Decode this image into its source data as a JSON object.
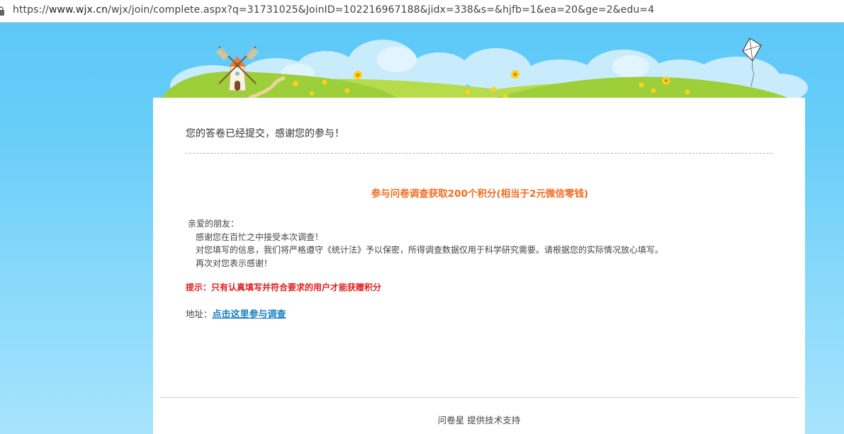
{
  "browser": {
    "url_prefix": "https://",
    "url_host": "www.wjx.cn",
    "url_rest": "/wjx/join/complete.aspx?q=31731025&JoinID=102216967188&jidx=338&s=&hjfb=1&ea=20&ge=2&edu=4",
    "lock_icon": "lock-icon"
  },
  "card": {
    "thanks": "您的答卷已经提交，感谢您的参与！",
    "promo": "参与问卷调查获取200个积分(相当于2元微信零钱)",
    "greeting": "亲爱的朋友：",
    "line1": "感谢您在百忙之中接受本次调查！",
    "line2": "对您填写的信息，我们将严格遵守《统计法》予以保密，所得调查数据仅用于科学研究需要。请根据您的实际情况放心填写。",
    "line3": "再次对您表示感谢！",
    "hint": "提示：只有认真填写并符合要求的用户才能获赠积分",
    "address_label": "地址：",
    "address_link": "点击这里参与调查",
    "footer": "问卷星 提供技术支持"
  },
  "colors": {
    "promo": "#f36c21",
    "hint": "#e02020",
    "link": "#1a7fc1",
    "sky": "#5ec9f7",
    "grass": "#9ccf3a"
  }
}
